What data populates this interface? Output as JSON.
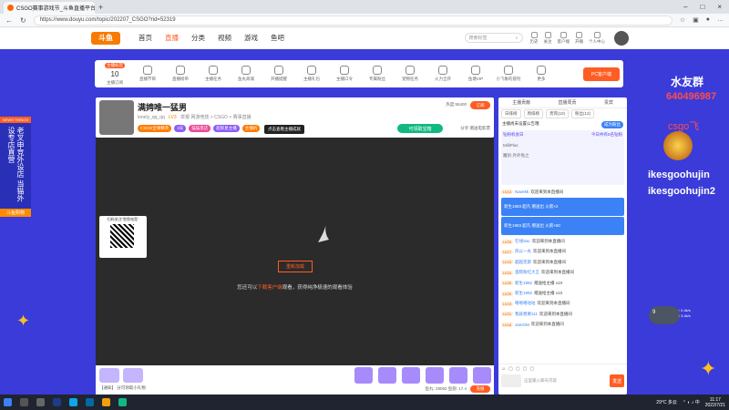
{
  "browser": {
    "tab_title": "CSGO赛事游戏节_斗鱼直播平台",
    "url": "https://www.douyu.com/topic/202207_CSGO?rid=52319"
  },
  "site": {
    "logo": "斗鱼",
    "nav": [
      "首页",
      "直播",
      "分类",
      "视频",
      "游戏",
      "鱼吧"
    ],
    "search_placeholder": "搜索标签",
    "header_icons": [
      "历史",
      "关注",
      "客户端",
      "开播",
      "个人中心"
    ]
  },
  "category_bar": {
    "first": {
      "badge": "主播标签",
      "count": "10",
      "label": "主播订阅"
    },
    "items": [
      "直播节目",
      "直播榜单",
      "主播任务",
      "鱼丸商城",
      "开播提醒",
      "主播礼包",
      "主播口令",
      "专属粉丝",
      "宠物任务",
      "火力全开",
      "鱼塘VIP",
      "小飞象的冒险",
      "更多"
    ],
    "pc_button": "PC客户端"
  },
  "left_promo": {
    "header": "NEWS·THINGS",
    "text": "老叉申竞外设店 当猫外设专店直营",
    "footer": "斗鱼购物"
  },
  "room": {
    "title": "满娉唯一猛男",
    "meta": "举报   网游竞技 > CSGO > 赛事直播",
    "owner": "lonely_qq_qq",
    "level": "LV3",
    "tags": [
      "CSGO全球精英",
      "3天",
      "猫猫黑店",
      "超新星主播",
      "主播机"
    ],
    "tooltip": "点击查看主播成就",
    "heat": "热度:55400",
    "follow": "订阅",
    "task_button": "可领取宝箱",
    "share": "分享   赠送电影票"
  },
  "player": {
    "button": "重新加载",
    "tip_pre": "您还可以",
    "tip_link": "下载客户端",
    "tip_post": "观看，获得纯净极速的观看体验",
    "qr_title": "扫码关注\"鱼鱼电竞\""
  },
  "gift_bar": {
    "info": "【通知】 分可领取小礼物",
    "balance": "鱼丸: 28092   鱼翅: 17.4",
    "recharge_label": "充值"
  },
  "chat": {
    "header": [
      "主播贡献",
      "直播周贡",
      "贵宾"
    ],
    "tabs": [
      "日排榜",
      "周排榜",
      "贵宾(10)",
      "粉丝(12)"
    ],
    "note": "主播尚未设置公告哦",
    "note_btn": "成为粉丝",
    "rank_title": "钻粉机会日",
    "rank_sub": "今日共有5名钻粉",
    "rank_rows": [
      "MilliPlus",
      "魔剑·外外兔之"
    ],
    "messages": [
      {
        "lv": "LV13",
        "name": "NaveMi",
        "text": "欢迎来到本直播间"
      },
      {
        "banner": "新生1983  超凡 赠送出 火箭×2"
      },
      {
        "banner": "新生1983  超凡 赠送出 火箭×50"
      },
      {
        "lv": "LV20",
        "name": "在线Sac",
        "text": "欢迎来到本直播间"
      },
      {
        "lv": "LV17",
        "name": "风以一丸",
        "text": "欢迎来到本直播间"
      },
      {
        "lv": "LV15",
        "name": "超越克斯",
        "text": "欢迎来到本直播间"
      },
      {
        "lv": "LV23",
        "name": "蛋糕粉红大王",
        "text": "欢迎来到本直播间"
      },
      {
        "lv": "LV25",
        "name": "新生1992",
        "text": "赠送给主播 x10"
      },
      {
        "lv": "LV20",
        "name": "新生1992",
        "text": "赠送给主播 x10"
      },
      {
        "lv": "LV19",
        "name": "咯咯咯咕咕",
        "text": "欢迎来到本直播间"
      },
      {
        "lv": "LV21",
        "name": "我就想要111",
        "text": "欢迎来到本直播间"
      },
      {
        "lv": "LV18",
        "name": "JamOM",
        "text": "欢迎来到本直播间"
      }
    ],
    "input_placeholder": "这里输入聊天内容",
    "send": "发送"
  },
  "overlay": {
    "name": "水友群",
    "qq": "640496987",
    "csgo": "csgo飞",
    "k1": "ikesgoohujin",
    "k2": "ikesgoohujin2",
    "ring_value": "9",
    "ring_up": "↑ 0.4k/s",
    "ring_down": "↓ 3.4k/s"
  },
  "taskbar": {
    "weather": "29°C 多云",
    "time": "11:17",
    "date": "2022/7/21"
  }
}
